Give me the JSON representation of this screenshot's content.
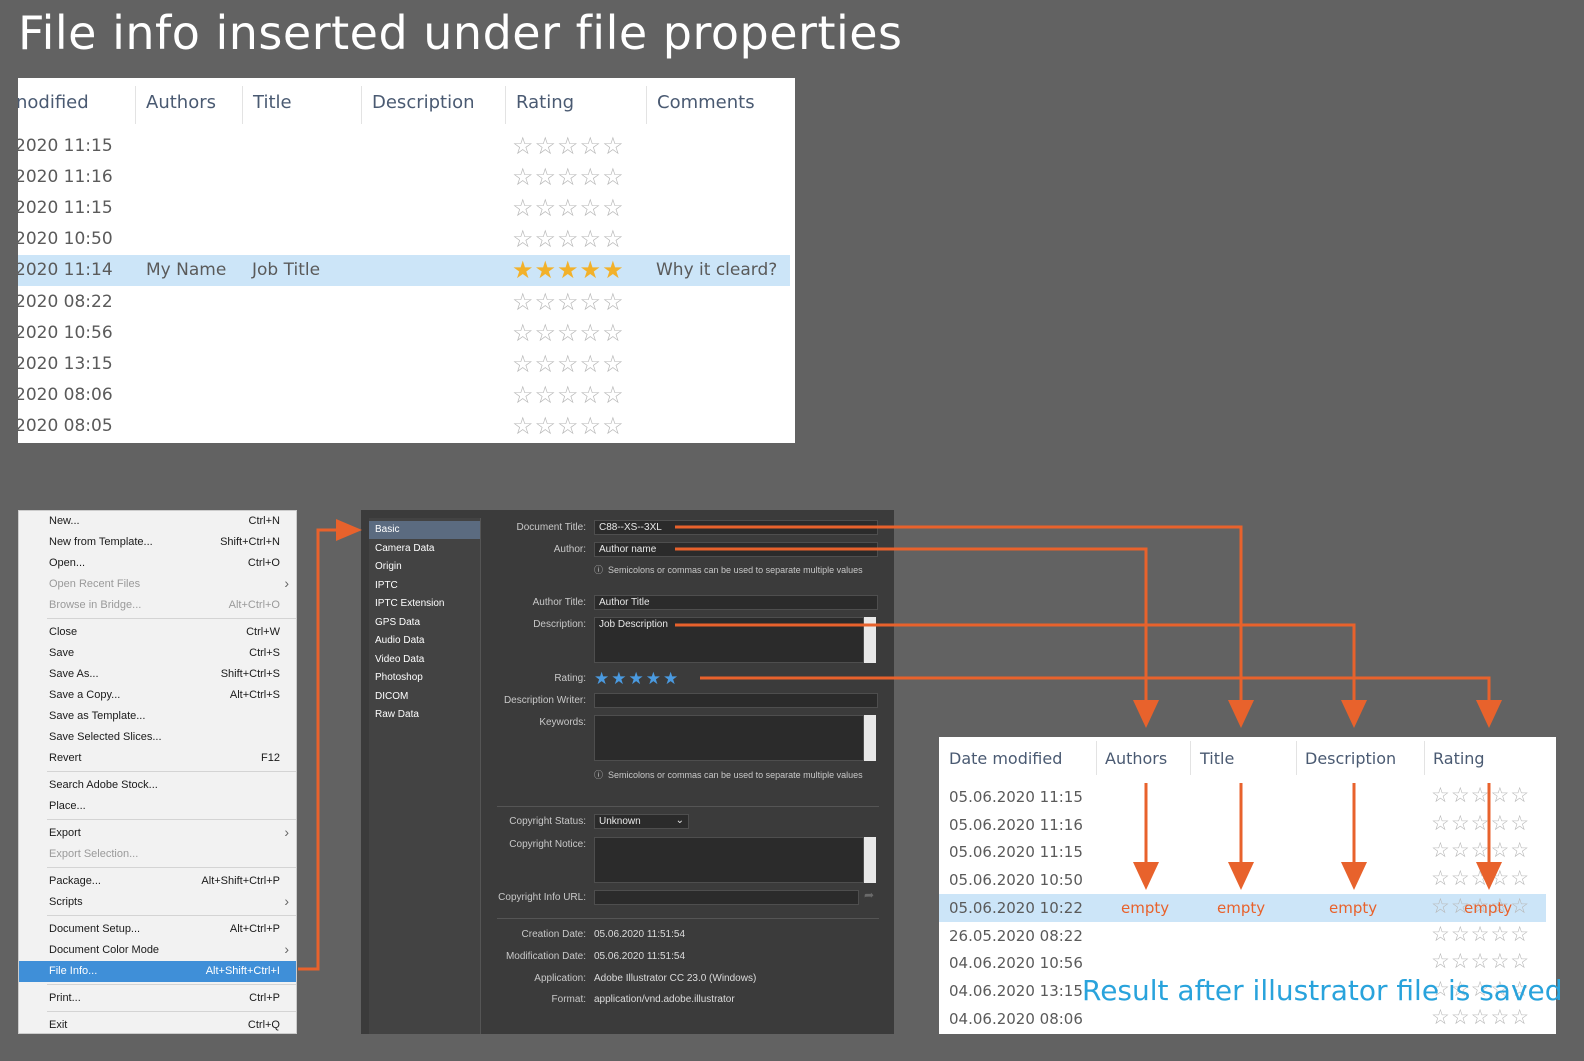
{
  "title": "File info inserted under file properties",
  "top_table": {
    "columns": [
      "nodified",
      "Authors",
      "Title",
      "Description",
      "Rating",
      "Comments"
    ],
    "rows": [
      {
        "date": "2020 11:15",
        "authors": "",
        "title": "",
        "comments": "",
        "rating": 0
      },
      {
        "date": "2020 11:16",
        "authors": "",
        "title": "",
        "comments": "",
        "rating": 0
      },
      {
        "date": "2020 11:15",
        "authors": "",
        "title": "",
        "comments": "",
        "rating": 0
      },
      {
        "date": "2020 10:50",
        "authors": "",
        "title": "",
        "comments": "",
        "rating": 0
      },
      {
        "date": "2020 11:14",
        "authors": "My Name",
        "title": "Job Title",
        "comments": "Why it cleard?",
        "rating": 5,
        "selected": true
      },
      {
        "date": "2020 08:22",
        "authors": "",
        "title": "",
        "comments": "",
        "rating": 0
      },
      {
        "date": "2020 10:56",
        "authors": "",
        "title": "",
        "comments": "",
        "rating": 0
      },
      {
        "date": "2020 13:15",
        "authors": "",
        "title": "",
        "comments": "",
        "rating": 0
      },
      {
        "date": "2020 08:06",
        "authors": "",
        "title": "",
        "comments": "",
        "rating": 0
      },
      {
        "date": "2020 08:05",
        "authors": "",
        "title": "",
        "comments": "",
        "rating": 0
      }
    ]
  },
  "menu": {
    "items": [
      {
        "label": "New...",
        "shortcut": "Ctrl+N"
      },
      {
        "label": "New from Template...",
        "shortcut": "Shift+Ctrl+N"
      },
      {
        "label": "Open...",
        "shortcut": "Ctrl+O"
      },
      {
        "label": "Open Recent Files",
        "shortcut": "",
        "submenu": true,
        "disabled": true
      },
      {
        "label": "Browse in Bridge...",
        "shortcut": "Alt+Ctrl+O",
        "disabled": true
      },
      {
        "label": "Close",
        "shortcut": "Ctrl+W"
      },
      {
        "label": "Save",
        "shortcut": "Ctrl+S"
      },
      {
        "label": "Save As...",
        "shortcut": "Shift+Ctrl+S"
      },
      {
        "label": "Save a Copy...",
        "shortcut": "Alt+Ctrl+S"
      },
      {
        "label": "Save as Template...",
        "shortcut": ""
      },
      {
        "label": "Save Selected Slices...",
        "shortcut": ""
      },
      {
        "label": "Revert",
        "shortcut": "F12"
      },
      {
        "label": "Search Adobe Stock...",
        "shortcut": ""
      },
      {
        "label": "Place...",
        "shortcut": ""
      },
      {
        "label": "Export",
        "shortcut": "",
        "submenu": true
      },
      {
        "label": "Export Selection...",
        "shortcut": "",
        "disabled": true
      },
      {
        "label": "Package...",
        "shortcut": "Alt+Shift+Ctrl+P"
      },
      {
        "label": "Scripts",
        "shortcut": "",
        "submenu": true
      },
      {
        "label": "Document Setup...",
        "shortcut": "Alt+Ctrl+P"
      },
      {
        "label": "Document Color Mode",
        "shortcut": "",
        "submenu": true
      },
      {
        "label": "File Info...",
        "shortcut": "Alt+Shift+Ctrl+I",
        "highlighted": true
      },
      {
        "label": "Print...",
        "shortcut": "Ctrl+P"
      },
      {
        "label": "Exit",
        "shortcut": "Ctrl+Q"
      }
    ]
  },
  "file_info": {
    "sidebar": [
      "Basic",
      "Camera Data",
      "Origin",
      "IPTC",
      "IPTC Extension",
      "GPS Data",
      "Audio Data",
      "Video Data",
      "Photoshop",
      "DICOM",
      "Raw Data"
    ],
    "labels": {
      "document_title": "Document Title:",
      "author": "Author:",
      "author_title": "Author Title:",
      "description": "Description:",
      "rating": "Rating:",
      "description_writer": "Description Writer:",
      "keywords": "Keywords:",
      "copyright_status": "Copyright Status:",
      "copyright_notice": "Copyright Notice:",
      "copyright_info_url": "Copyright Info URL:",
      "creation_date": "Creation Date:",
      "modification_date": "Modification Date:",
      "application": "Application:",
      "format": "Format:"
    },
    "values": {
      "document_title": "C88--XS--3XL",
      "author": "Author name",
      "author_title": "Author Title",
      "description": "Job Description",
      "rating": 5,
      "description_writer": "",
      "keywords": "",
      "copyright_status": "Unknown",
      "copyright_notice": "",
      "copyright_info_url": "",
      "creation_date": "05.06.2020 11:51:54",
      "modification_date": "05.06.2020 11:51:54",
      "application": "Adobe Illustrator CC 23.0 (Windows)",
      "format": "application/vnd.adobe.illustrator"
    },
    "note": "Semicolons or commas can be used to separate multiple values"
  },
  "bottom_table": {
    "columns": [
      "Date modified",
      "Authors",
      "Title",
      "Description",
      "Rating"
    ],
    "rows": [
      {
        "date": "05.06.2020 11:15"
      },
      {
        "date": "05.06.2020 11:16"
      },
      {
        "date": "05.06.2020 11:15"
      },
      {
        "date": "05.06.2020 10:50"
      },
      {
        "date": "05.06.2020 10:22",
        "selected": true
      },
      {
        "date": "26.05.2020 08:22"
      },
      {
        "date": "04.06.2020 10:56"
      },
      {
        "date": "04.06.2020 13:15"
      },
      {
        "date": "04.06.2020 08:06"
      }
    ],
    "empty_label": "empty"
  },
  "result_caption": "Result after illustrator file is saved",
  "colors": {
    "arrow": "#e8622c",
    "caption": "#29a3dc",
    "star_gold": "#f2b12a",
    "star_blue": "#4a9ae0",
    "selection": "#cce5f8",
    "menu_highlight": "#3f8fd8"
  }
}
